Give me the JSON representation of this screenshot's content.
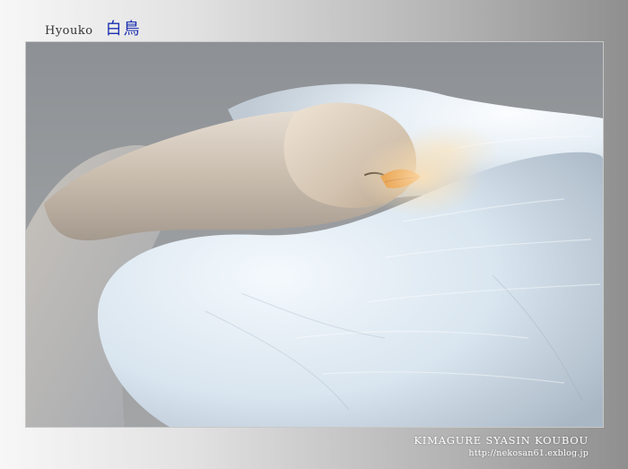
{
  "header": {
    "location_label": "Hyouko",
    "title_japanese": "白鳥"
  },
  "photo": {
    "subject": "swan-resting-icon"
  },
  "footer": {
    "studio_name": "KIMAGURE SYASIN KOUBOU",
    "blog_url": "http://nekosan61.exblog.jp"
  },
  "colors": {
    "title_accent": "#1a2fb0",
    "feather_white": "#f2f7fb",
    "beak_orange": "#e08a2a"
  }
}
